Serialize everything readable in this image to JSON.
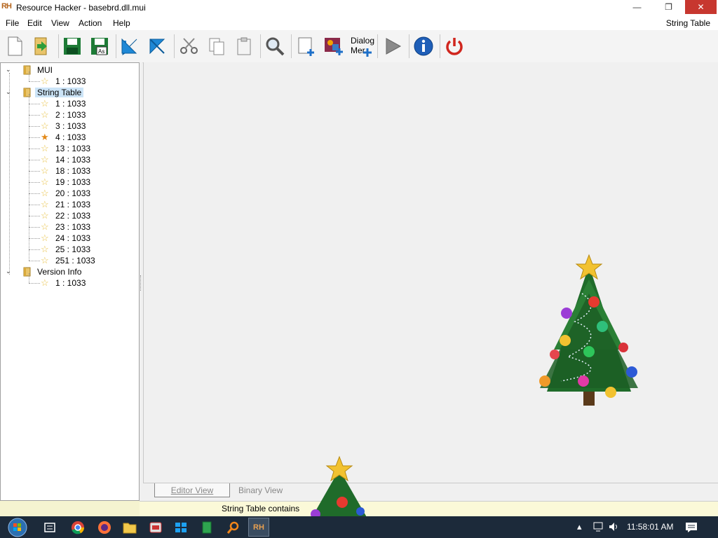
{
  "window": {
    "app_icon_text": "RH",
    "title": "Resource Hacker - basebrd.dll.mui",
    "min_glyph": "—",
    "max_glyph": "❐",
    "close_glyph": "✕"
  },
  "menu": {
    "items": [
      "File",
      "Edit",
      "View",
      "Action",
      "Help"
    ],
    "right_label": "String Table"
  },
  "toolbar": {
    "dialog_menu_line1": "Dialog",
    "dialog_menu_line2": "Mer"
  },
  "tree": {
    "groups": [
      {
        "label": "MUI",
        "expanded": true,
        "items": [
          {
            "label": "1 : 1033"
          }
        ]
      },
      {
        "label": "String Table",
        "expanded": true,
        "selected": true,
        "items": [
          {
            "label": "1 : 1033"
          },
          {
            "label": "2 : 1033"
          },
          {
            "label": "3 : 1033"
          },
          {
            "label": "4 : 1033",
            "highlighted": true
          },
          {
            "label": "13 : 1033"
          },
          {
            "label": "14 : 1033"
          },
          {
            "label": "18 : 1033"
          },
          {
            "label": "19 : 1033"
          },
          {
            "label": "20 : 1033"
          },
          {
            "label": "21 : 1033"
          },
          {
            "label": "22 : 1033"
          },
          {
            "label": "23 : 1033"
          },
          {
            "label": "24 : 1033"
          },
          {
            "label": "25 : 1033"
          },
          {
            "label": "251 : 1033"
          }
        ]
      },
      {
        "label": "Version Info",
        "expanded": true,
        "items": [
          {
            "label": "1 : 1033"
          }
        ]
      }
    ]
  },
  "tabs": {
    "editor": "Editor View",
    "binary": "Binary View"
  },
  "status": {
    "text": "String Table contains"
  },
  "taskbar": {
    "clock": "11:58:01 AM",
    "active_app": "RH"
  },
  "colors": {
    "close_button": "#c7372f",
    "selection": "#cce4f7",
    "status_bar": "#fbf9d8",
    "taskbar": "#1c2a3a",
    "tree_green": "#1f6b2a",
    "ornament_gold": "#f2c230"
  }
}
